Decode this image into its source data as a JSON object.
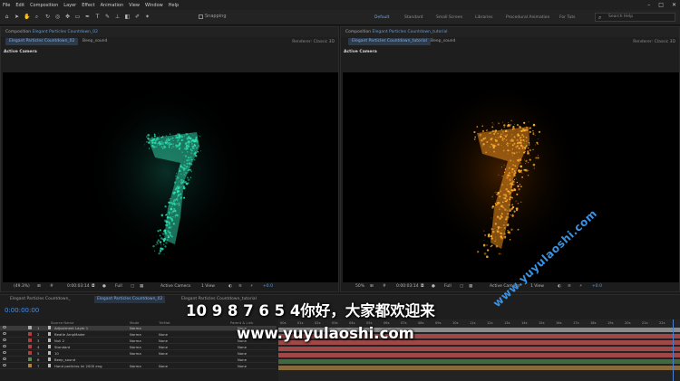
{
  "menu": [
    "File",
    "Edit",
    "Composition",
    "Layer",
    "Effect",
    "Animation",
    "View",
    "Window",
    "Help"
  ],
  "toolbar": {
    "snapping": "Snapping",
    "workspaces": [
      "Default",
      "Standard",
      "Small Screen",
      "Libraries",
      "Procedural Animation",
      "For Tuts"
    ],
    "search_placeholder": "Search Help"
  },
  "left_panel": {
    "title_prefix": "Composition",
    "title_name": "Elegant Particles Countdown_02",
    "tabs": [
      "Elegant Particles Countdown_02",
      "Beep_sound"
    ],
    "renderer": "Renderer:  Classic 3D",
    "camera": "Active Camera",
    "footer": {
      "zoom": "(49.3%)",
      "time": "0:00:03:14",
      "res": "Full",
      "cam": "Active Camera",
      "views": "1 View",
      "offset": "+0.0"
    },
    "particle_color": "#2fe0b0"
  },
  "right_panel": {
    "title_prefix": "Composition",
    "title_name": "Elegant Particles Countdown_tutorial",
    "tabs": [
      "Elegant Particles Countdown_tutorial",
      "Beep_sound"
    ],
    "renderer": "Renderer:  Classic 3D",
    "camera": "Active Camera",
    "footer": {
      "zoom": "50%",
      "time": "0:00:03:14",
      "res": "Full",
      "cam": "Active Camera",
      "views": "1 View",
      "offset": "+0.0"
    },
    "particle_color": "#ffb030"
  },
  "timeline": {
    "tabs": [
      "Elegant Particles Countdown_",
      "Elegant Particles Countdown_02",
      "Elegant Particles Countdown_tutorial"
    ],
    "timecode": "0:00:00:00",
    "column_headers": {
      "name": "Source Name",
      "mode": "Mode",
      "trkmat": "TrkMat",
      "parent": "Parent & Link"
    },
    "layers": [
      {
        "num": "1",
        "name": "Adjustment Layer 1",
        "mode": "Norma",
        "trk": "",
        "parent": "None",
        "color": "#a8a8a8"
      },
      {
        "num": "2",
        "name": "Beatle AmpMader",
        "mode": "Norma",
        "trk": "None",
        "parent": "None",
        "color": "#b04040"
      },
      {
        "num": "3",
        "name": "Null 2",
        "mode": "Norma",
        "trk": "None",
        "parent": "None",
        "color": "#b04040"
      },
      {
        "num": "4",
        "name": "Standard",
        "mode": "Norma",
        "trk": "None",
        "parent": "None",
        "color": "#b04040"
      },
      {
        "num": "5",
        "name": "10",
        "mode": "Norma",
        "trk": "None",
        "parent": "None",
        "color": "#b04040"
      },
      {
        "num": "6",
        "name": "Beep_sound",
        "mode": "",
        "trk": "",
        "parent": "None",
        "color": "#5a8a5a"
      },
      {
        "num": "7",
        "name": "Hand particles Ini 2000 eng",
        "mode": "Norma",
        "trk": "None",
        "parent": "None",
        "color": "#b08040"
      }
    ],
    "ruler": [
      "00s",
      "01s",
      "02s",
      "03s",
      "04s",
      "05s",
      "06s",
      "07s",
      "08s",
      "09s",
      "10s",
      "11s",
      "12s",
      "13s",
      "14s",
      "15s",
      "16s",
      "17s",
      "18s",
      "19s",
      "20s",
      "21s",
      "22s"
    ]
  },
  "subtitle": {
    "line1": "10 9 8 7 6 5 4你好，大家都欢迎来",
    "line2": "www.yuyulaoshi.com"
  },
  "watermark": "www.yuyulaoshi.com",
  "icons": [
    "home-icon",
    "arrow-icon",
    "hand-icon",
    "zoom-icon",
    "rotate-icon",
    "camera-orbit-icon",
    "pan-icon",
    "rect-icon",
    "pen-icon",
    "type-icon",
    "brush-icon",
    "stamp-icon",
    "eraser-icon",
    "roto-icon",
    "pin-icon"
  ]
}
